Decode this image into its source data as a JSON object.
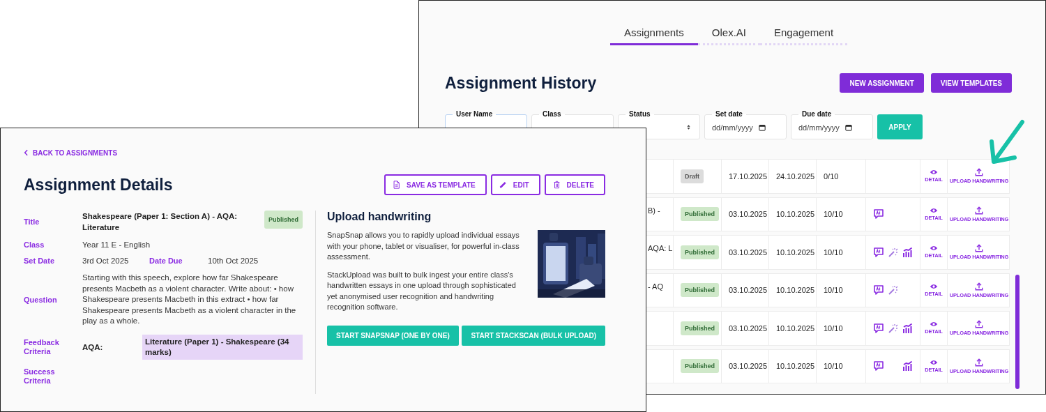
{
  "history": {
    "tabs": [
      {
        "label": "Assignments",
        "selected": true
      },
      {
        "label": "Olex.AI",
        "selected": false
      },
      {
        "label": "Engagement",
        "selected": false
      }
    ],
    "title": "Assignment History",
    "buttons": [
      "NEW ASSIGNMENT",
      "VIEW TEMPLATES"
    ],
    "filters": [
      {
        "label": "User Name",
        "kind": "text",
        "focused": true
      },
      {
        "label": "Class",
        "kind": "text",
        "focused": false
      },
      {
        "label": "Status",
        "kind": "select",
        "focused": false
      },
      {
        "label": "Set date",
        "kind": "date",
        "placeholder": "dd/mm/yyyy",
        "focused": false
      },
      {
        "label": "Due date",
        "kind": "date",
        "placeholder": "dd/mm/yyyy",
        "focused": false
      }
    ],
    "apply_button": "APPLY",
    "rows": [
      {
        "status": "Draft",
        "color": "#dcdcdc",
        "set_date": "17.10.2025",
        "due_date": "24.10.2025",
        "count": "0/10",
        "feedback": false,
        "wand": false,
        "chart": false,
        "detail": "DETAIL",
        "upload": "UPLOAD HANDWRITING"
      },
      {
        "title_fragment": "B) -",
        "status": "Published",
        "color": "#cfe8c9",
        "set_date": "03.10.2025",
        "due_date": "10.10.2025",
        "count": "10/10",
        "feedback": true,
        "wand": false,
        "chart": false,
        "detail": "DETAIL",
        "upload": "UPLOAD HANDWRITING"
      },
      {
        "title_fragment": "AQA: L",
        "status": "Published",
        "color": "#cfe8c9",
        "set_date": "03.10.2025",
        "due_date": "10.10.2025",
        "count": "10/10",
        "feedback": true,
        "wand": true,
        "chart": true,
        "detail": "DETAIL",
        "upload": "UPLOAD HANDWRITING"
      },
      {
        "title_fragment": "- AQ",
        "status": "Published",
        "color": "#cfe8c9",
        "set_date": "03.10.2025",
        "due_date": "10.10.2025",
        "count": "10/10",
        "feedback": true,
        "wand": true,
        "chart": false,
        "detail": "DETAIL",
        "upload": "UPLOAD HANDWRITING"
      },
      {
        "status": "Published",
        "color": "#cfe8c9",
        "set_date": "03.10.2025",
        "due_date": "10.10.2025",
        "count": "10/10",
        "feedback": true,
        "wand": true,
        "chart": true,
        "detail": "DETAIL",
        "upload": "UPLOAD HANDWRITING"
      },
      {
        "status": "Published",
        "color": "#cfe8c9",
        "set_date": "03.10.2025",
        "due_date": "10.10.2025",
        "count": "10/10",
        "feedback": true,
        "wand": false,
        "chart": true,
        "detail": "DETAIL",
        "upload": "UPLOAD HANDWRITING"
      }
    ]
  },
  "details": {
    "back_link": "BACK TO ASSIGNMENTS",
    "title": "Assignment Details",
    "actions": [
      "SAVE AS TEMPLATE",
      "EDIT",
      "DELETE"
    ],
    "title_field": {
      "label": "Title",
      "value": "Shakespeare (Paper 1: Section A) - AQA: Literature",
      "status": "Published",
      "color": "#cfe8c9"
    },
    "class_field": {
      "label": "Class",
      "value": "Year 11 E - English"
    },
    "dates": {
      "set_label": "Set Date",
      "set_value": "3rd Oct 2025",
      "due_label": "Date Due",
      "due_value": "10th Oct 2025"
    },
    "question": {
      "label": "Question",
      "value": "Starting with this speech, explore how far Shakespeare presents Macbeth as a violent character. Write about: • how Shakespeare presents Macbeth in this extract • how far Shakespeare presents Macbeth as a violent character in the play as a whole."
    },
    "feedback": {
      "label": "Feedback Criteria",
      "board": "AQA:",
      "criteria": "Literature (Paper 1) - Shakespeare (34 marks)"
    },
    "success": {
      "label": "Success Criteria"
    },
    "upload": {
      "heading": "Upload handwriting",
      "paragraphs": [
        "SnapSnap allows you to rapidly upload individual essays with your phone, tablet or visualiser, for powerful in-class assessment.",
        "StackUpload was built to bulk ingest your entire class's handwritten essays in one upload through sophisticated yet anonymised user recognition and handwriting recognition software."
      ],
      "image": {
        "kind": "picture"
      },
      "buttons": [
        "START SNAPSNAP (ONE BY ONE)",
        "START STACKSCAN (BULK UPLOAD)"
      ]
    }
  }
}
